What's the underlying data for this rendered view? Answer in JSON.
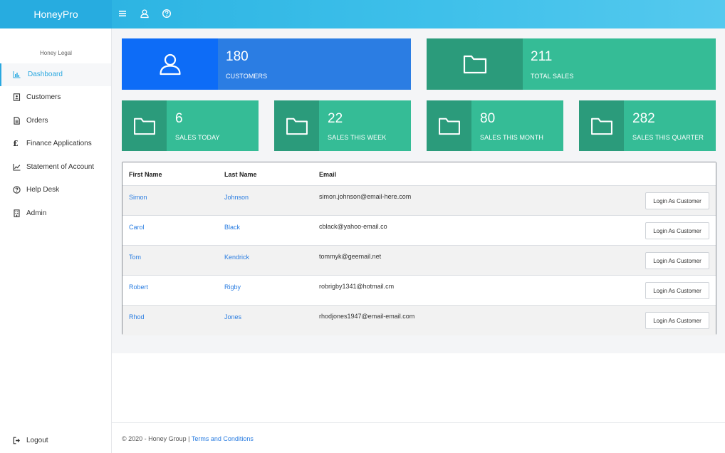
{
  "app": {
    "brand": "HoneyPro"
  },
  "topbar": {
    "icons": [
      "menu-icon",
      "user-icon",
      "help-icon"
    ]
  },
  "sidebar": {
    "org_label": "Honey Legal",
    "items": [
      {
        "label": "Dashboard",
        "icon": "bar-chart-icon",
        "active": true
      },
      {
        "label": "Customers",
        "icon": "address-book-icon"
      },
      {
        "label": "Orders",
        "icon": "document-icon"
      },
      {
        "label": "Finance Applications",
        "icon": "pound-icon"
      },
      {
        "label": "Statement of Account",
        "icon": "line-chart-icon"
      },
      {
        "label": "Help Desk",
        "icon": "help-icon"
      },
      {
        "label": "Admin",
        "icon": "building-icon"
      }
    ],
    "logout": {
      "label": "Logout",
      "icon": "sign-out-icon"
    }
  },
  "stats": {
    "customers": {
      "value": "180",
      "label": "CUSTOMERS",
      "color": "#2b7de3",
      "icon_color": "#0d6cf7"
    },
    "total_sales": {
      "value": "211",
      "label": "TOTAL SALES",
      "color": "#35bc96",
      "icon_color": "#2b9b7b"
    },
    "today": {
      "value": "6",
      "label": "SALES TODAY"
    },
    "week": {
      "value": "22",
      "label": "SALES THIS WEEK"
    },
    "month": {
      "value": "80",
      "label": "SALES THIS MONTH"
    },
    "quarter": {
      "value": "282",
      "label": "SALES THIS QUARTER"
    }
  },
  "table": {
    "headers": {
      "first": "First Name",
      "last": "Last Name",
      "email": "Email"
    },
    "action_label": "Login As Customer",
    "rows": [
      {
        "first": "Simon",
        "last": "Johnson",
        "email": "simon.johnson@email-here.com"
      },
      {
        "first": "Carol",
        "last": "Black",
        "email": "cblack@yahoo-email.co"
      },
      {
        "first": "Tom",
        "last": "Kendrick",
        "email": "tommyk@geemail.net"
      },
      {
        "first": "Robert",
        "last": "Rigby",
        "email": "robrigby1341@hotmail.cm"
      },
      {
        "first": "Rhod",
        "last": "Jones",
        "email": "rhodjones1947@email-email.com"
      }
    ]
  },
  "footer": {
    "copyright": "© 2020 - Honey Group | ",
    "terms": "Terms and Conditions"
  }
}
